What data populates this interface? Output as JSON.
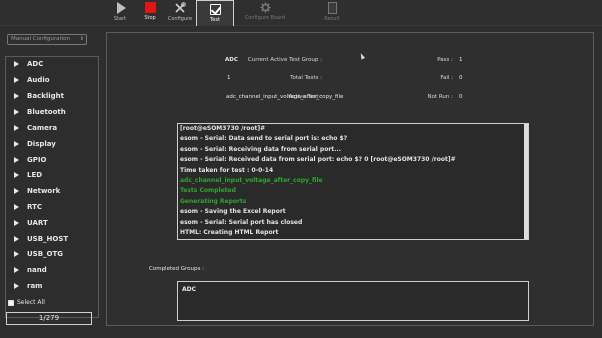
{
  "toolbar": {
    "start_label": "Start",
    "stop_label": "Stop",
    "configure_label": "Configure",
    "test_label": "Test",
    "configure_board_label": "Configure Board",
    "result_label": "Result",
    "stop_color": "#e01616"
  },
  "sidebar": {
    "config_select_value": "Manual Configuration",
    "items": [
      {
        "label": "ADC"
      },
      {
        "label": "Audio"
      },
      {
        "label": "Backlight"
      },
      {
        "label": "Bluetooth"
      },
      {
        "label": "Camera"
      },
      {
        "label": "Display"
      },
      {
        "label": "GPIO"
      },
      {
        "label": "LED"
      },
      {
        "label": "Network"
      },
      {
        "label": "RTC"
      },
      {
        "label": "UART"
      },
      {
        "label": "USB_HOST"
      },
      {
        "label": "USB_OTG"
      },
      {
        "label": "nand"
      },
      {
        "label": "ram"
      }
    ],
    "select_all_label": "Select All",
    "counter": "1/279"
  },
  "status": {
    "current_group_label": "Current Active Test Group :",
    "current_group_value": "ADC",
    "total_tests_label": "Total Tests :",
    "total_tests_value": "1",
    "active_test_label": "Active Test :",
    "active_test_value": "adc_channel_input_voltage_after_copy_file",
    "pass_label": "Pass :",
    "pass_value": "1",
    "fail_label": "Fail :",
    "fail_value": "0",
    "notrun_label": "Not Run :",
    "notrun_value": "0"
  },
  "console": {
    "lines": [
      {
        "text": "[root@eSOM3730 /root]#",
        "color": "#e4e4e4"
      },
      {
        "text": "esom - Serial: Data send to serial port is: echo $?",
        "color": "#e4e4e4"
      },
      {
        "text": "esom - Serial: Receiving data from serial port...",
        "color": "#e4e4e4"
      },
      {
        "text": "esom - Serial: Received data from serial port: echo $? 0 [root@eSOM3730 /root]#",
        "color": "#e4e4e4"
      },
      {
        "text": "Time taken for test : 0-0-14",
        "color": "#e4e4e4"
      },
      {
        "text": "adc_channel_input_voltage_after_copy_file",
        "color": "#2fa52f"
      },
      {
        "text": "Tests Completed",
        "color": "#2fa52f"
      },
      {
        "text": "Generating Reports",
        "color": "#2fa52f"
      },
      {
        "text": "esom - Saving the Excel Report",
        "color": "#e4e4e4"
      },
      {
        "text": "esom - Serial: Serial port has closed",
        "color": "#e4e4e4"
      },
      {
        "text": "HTML: Creating HTML Report",
        "color": "#e4e4e4"
      }
    ]
  },
  "completed": {
    "label": "Completed Groups :",
    "groups": [
      "ADC"
    ]
  }
}
